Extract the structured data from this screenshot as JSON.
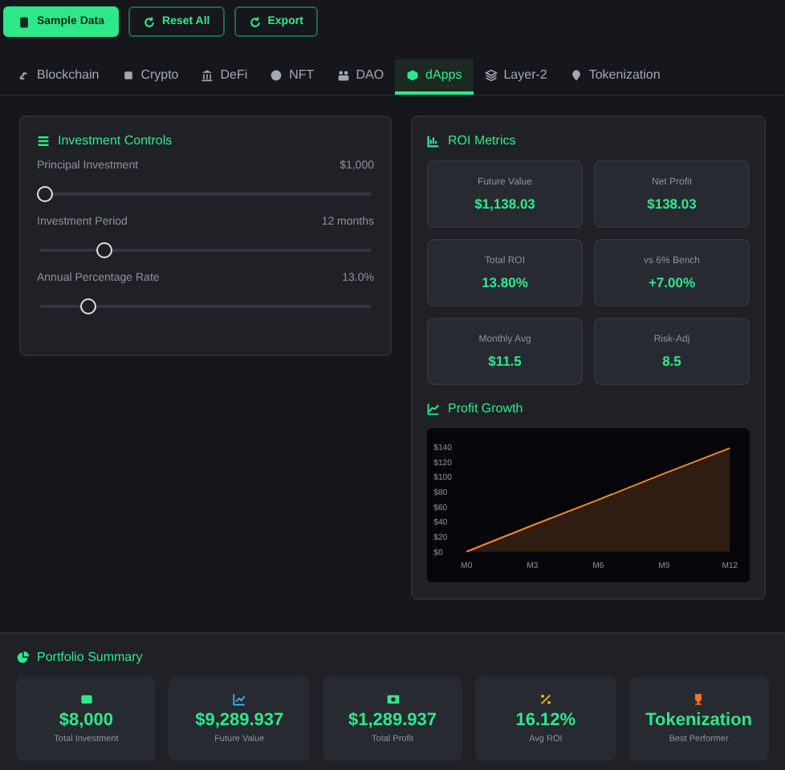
{
  "toolbar": {
    "buttons": [
      {
        "label": "Sample Data",
        "kind": "primary"
      },
      {
        "label": "Reset All",
        "kind": "outline"
      },
      {
        "label": "Export",
        "kind": "outline"
      }
    ]
  },
  "tabs": [
    {
      "label": "Blockchain",
      "selected": false
    },
    {
      "label": "Crypto",
      "selected": false
    },
    {
      "label": "DeFi",
      "selected": false
    },
    {
      "label": "NFT",
      "selected": false
    },
    {
      "label": "DAO",
      "selected": false
    },
    {
      "label": "dApps",
      "selected": true
    },
    {
      "label": "Layer-2",
      "selected": false
    },
    {
      "label": "Tokenization",
      "selected": false
    }
  ],
  "controls": {
    "title": "Investment Controls",
    "sliders": [
      {
        "label": "Principal Investment",
        "reading": "$1,000",
        "level": 0.01
      },
      {
        "label": "Investment Period",
        "reading": "12 months",
        "level": 0.19
      },
      {
        "label": "Annual Percentage Rate",
        "reading": "13.0%",
        "level": 0.14
      }
    ]
  },
  "roi": {
    "title": "ROI Metrics",
    "metrics": [
      {
        "label": "Future Value",
        "value": "$1,138.03"
      },
      {
        "label": "Net Profit",
        "value": "$138.03"
      },
      {
        "label": "Total ROI",
        "value": "13.80%"
      },
      {
        "label": "vs 6% Bench",
        "value": "+7.00%"
      },
      {
        "label": "Monthly Avg",
        "value": "$11.5"
      },
      {
        "label": "Risk-Adj",
        "value": "8.5"
      }
    ],
    "chart_title": "Profit Growth",
    "chart_data": {
      "type": "area",
      "categories": [
        "M0",
        "M3",
        "M6",
        "M9",
        "M12"
      ],
      "ylim": [
        0,
        160
      ],
      "series": [
        {
          "color": "#f08a2c",
          "values": [
            0,
            35,
            69,
            104,
            138
          ]
        }
      ],
      "yticks": [
        {
          "value": 0,
          "label": "$0"
        },
        {
          "value": 20,
          "label": "$20"
        },
        {
          "value": 40,
          "label": "$40"
        },
        {
          "value": 60,
          "label": "$60"
        },
        {
          "value": 80,
          "label": "$80"
        },
        {
          "value": 100,
          "label": "$100"
        },
        {
          "value": 120,
          "label": "$120"
        },
        {
          "value": 140,
          "label": "$140"
        }
      ]
    }
  },
  "summary": {
    "title": "Portfolio Summary",
    "cards": [
      {
        "kind": "wallet",
        "value": "$8,000",
        "label": "Total Investment",
        "color": "#2ee88a"
      },
      {
        "kind": "chart",
        "value": "$9,289.937",
        "label": "Future Value",
        "color": "#38bdf8"
      },
      {
        "kind": "money",
        "value": "$1,289.937",
        "label": "Total Profit",
        "color": "#2ee88a"
      },
      {
        "kind": "percent",
        "value": "16.12%",
        "label": "Avg ROI",
        "color": "#eab308"
      },
      {
        "kind": "trophy",
        "value": "Tokenization",
        "label": "Best Performer",
        "color": "#f97316"
      }
    ]
  }
}
